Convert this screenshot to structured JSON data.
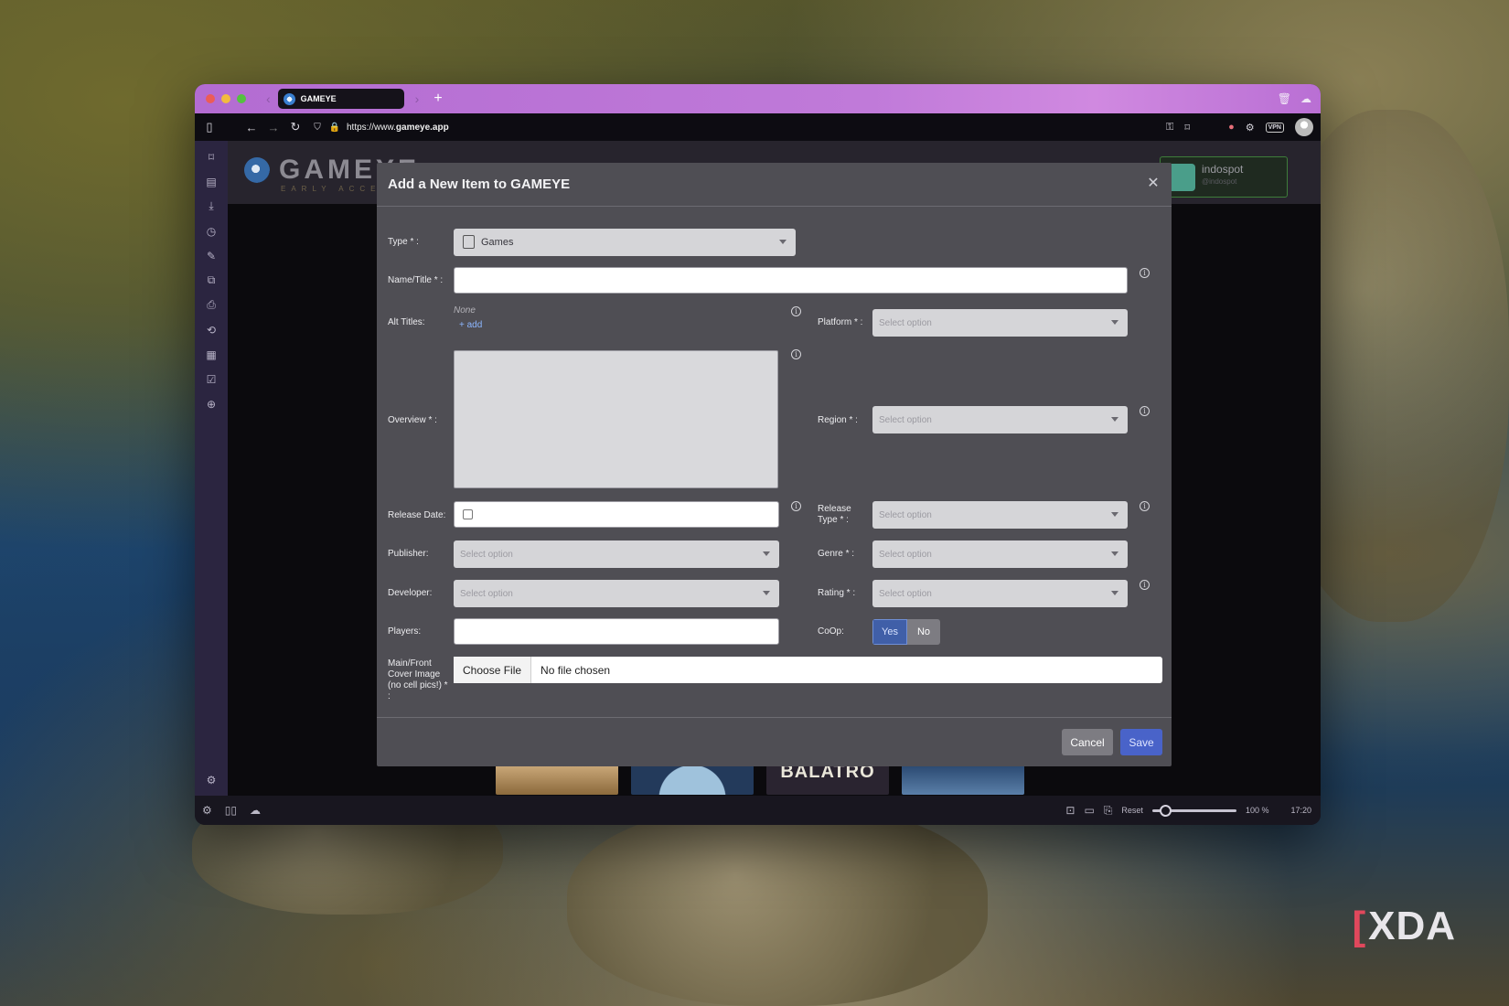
{
  "browser": {
    "tab_title": "GAMEYE",
    "url_prefix": "https://www.",
    "url_domain": "gameye.app",
    "vpn_label": "VPN"
  },
  "site": {
    "logo_text": "GAMEYE",
    "logo_sub": "EARLY ACCESS",
    "user_name": "indospot",
    "user_handle": "@indospot",
    "thumb_balatro": "BALATRO"
  },
  "statusbar": {
    "reset_label": "Reset",
    "zoom_level": "100 %",
    "zoom_fraction": 0.1,
    "clock": "17:20"
  },
  "modal": {
    "title": "Add a New Item to GAMEYE",
    "labels": {
      "type": "Type * :",
      "name_title": "Name/Title * :",
      "alt_titles": "Alt Titles:",
      "overview": "Overview * :",
      "release_date": "Release Date:",
      "publisher": "Publisher:",
      "developer": "Developer:",
      "players": "Players:",
      "cover_image": "Main/Front Cover Image (no cell pics!) * :",
      "platform": "Platform * :",
      "region": "Region * :",
      "release_type": "Release Type * :",
      "genre": "Genre * :",
      "rating": "Rating * :",
      "coop": "CoOp:"
    },
    "type_value": "Games",
    "select_placeholder": "Select option",
    "alt_titles_value": "None",
    "alt_titles_add": "+ add",
    "coop_yes": "Yes",
    "coop_no": "No",
    "coop_selected": "Yes",
    "file_button": "Choose File",
    "file_status": "No file chosen",
    "cancel_label": "Cancel",
    "save_label": "Save"
  },
  "colors": {
    "tab_accent": "#c07ad9",
    "modal_bg": "#4f4e54",
    "save_button": "#4963c9",
    "coop_selected": "#405fa8"
  }
}
